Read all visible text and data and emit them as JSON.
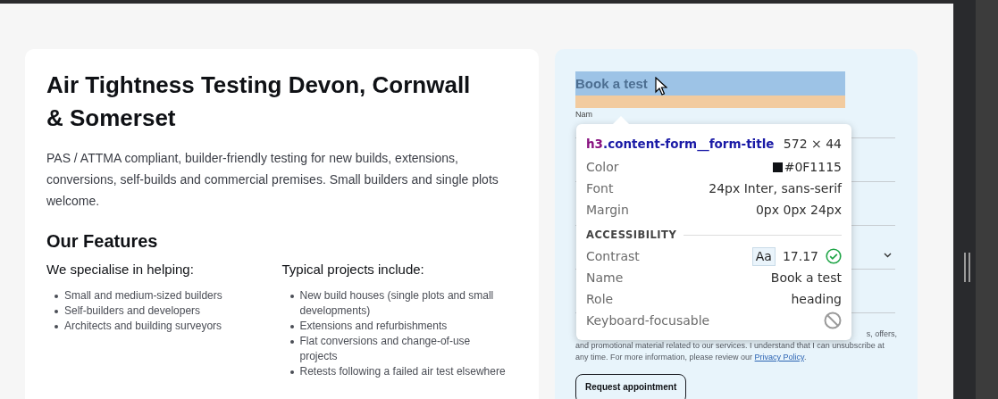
{
  "intro": {
    "title": "Air Tightness Testing Devon,  Cornwall & Somerset",
    "description": "PAS / ATTMA compliant, builder-friendly testing for new builds, extensions, conversions, self-builds and commercial premises. Small builders and single plots welcome."
  },
  "features": {
    "heading": "Our Features",
    "columns": [
      {
        "heading": "We specialise in helping:",
        "items": [
          "Small and medium-sized builders",
          "Self-builders and developers",
          "Architects and building surveyors"
        ]
      },
      {
        "heading": "Typical projects include:",
        "items": [
          "New build houses (single plots and small developments)",
          "Extensions and refurbishments",
          "Flat conversions and change-of-use projects",
          "Retests following a failed air test elsewhere"
        ]
      }
    ]
  },
  "form": {
    "title": "Book a test",
    "first_label": "Nam",
    "fields": [
      {
        "kind": "input"
      },
      {
        "kind": "input"
      },
      {
        "kind": "input"
      },
      {
        "kind": "select"
      },
      {
        "kind": "input"
      }
    ],
    "consent_lines": [
      "s, offers,",
      "and promotional material related to our services. I understand that I can unsubscribe at"
    ],
    "consent_last": "any time. For more information, please review our",
    "privacy_link": "Privacy Policy",
    "consent_end": ".",
    "submit": "Request appointment"
  },
  "inspector_tooltip": {
    "tag": "h3",
    "class_name": ".content-form__form-title",
    "size": "572 × 44",
    "properties": [
      {
        "kind": "color",
        "label": "Color",
        "value": "#0F1115"
      },
      {
        "kind": "text",
        "label": "Font",
        "value": "24px Inter, sans-serif"
      },
      {
        "kind": "text",
        "label": "Margin",
        "value": "0px 0px 24px"
      }
    ],
    "section_title": "ACCESSIBILITY",
    "accessibility": [
      {
        "kind": "contrast",
        "label": "Contrast",
        "sample": "Aa",
        "value": "17.17",
        "passes": true
      },
      {
        "kind": "text",
        "label": "Name",
        "value": "Book a test"
      },
      {
        "kind": "text",
        "label": "Role",
        "value": "heading"
      },
      {
        "kind": "flag",
        "label": "Keyboard-focusable",
        "on": false
      }
    ]
  }
}
